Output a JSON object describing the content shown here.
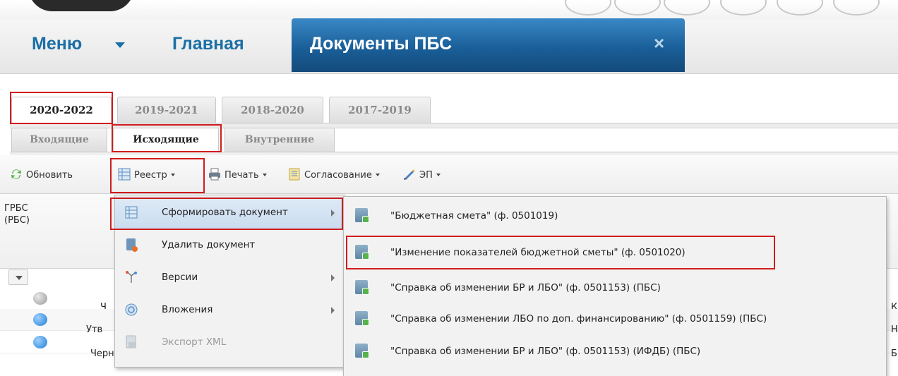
{
  "header": {
    "menu_label": "Меню",
    "home_label": "Главная",
    "active_tab_label": "Документы ПБС",
    "close_symbol": "×"
  },
  "period_tabs": [
    "2020-2022",
    "2019-2021",
    "2018-2020",
    "2017-2019"
  ],
  "doc_tabs": [
    "Входящие",
    "Исходящие",
    "Внутренние"
  ],
  "toolbar": {
    "refresh": "Обновить",
    "registry": "Реестр",
    "print": "Печать",
    "approval": "Согласование",
    "ep": "ЭП"
  },
  "grid": {
    "col_grbs": "ГРБС\n(РБС)",
    "rows": [
      {
        "status_color": "#a8a8a8",
        "text": "Ч",
        "right": "К"
      },
      {
        "status_color": "#2f8fe0",
        "text": "Утв",
        "right": "Н"
      },
      {
        "status_color": "#2f8fe0",
        "text": "Черновик",
        "right": "БР"
      }
    ]
  },
  "context_menu": [
    {
      "label": "Сформировать документ",
      "icon": "registry-icon",
      "submenu": true,
      "enabled": true
    },
    {
      "label": "Удалить документ",
      "icon": "delete-doc-icon",
      "submenu": false,
      "enabled": true
    },
    {
      "label": "Версии",
      "icon": "versions-icon",
      "submenu": true,
      "enabled": true
    },
    {
      "label": "Вложения",
      "icon": "attachments-icon",
      "submenu": true,
      "enabled": true
    },
    {
      "label": "Экспорт XML",
      "icon": "export-xml-icon",
      "submenu": false,
      "enabled": false
    }
  ],
  "submenu": [
    "\"Бюджетная смета\" (ф. 0501019)",
    "\"Изменение показателей бюджетной сметы\" (ф. 0501020)",
    "\"Справка об изменении БР и ЛБО\" (ф. 0501153) (ПБС)",
    "\"Справка об изменении ЛБО по доп. финансированию\" (ф. 0501159) (ПБС)",
    "\"Справка об изменении БР и ЛБО\" (ф. 0501153) (ИФДБ) (ПБС)"
  ],
  "colors": {
    "accent": "#1b6fa6",
    "highlight": "#d01c1c",
    "active_tab": "#1a5f99"
  }
}
